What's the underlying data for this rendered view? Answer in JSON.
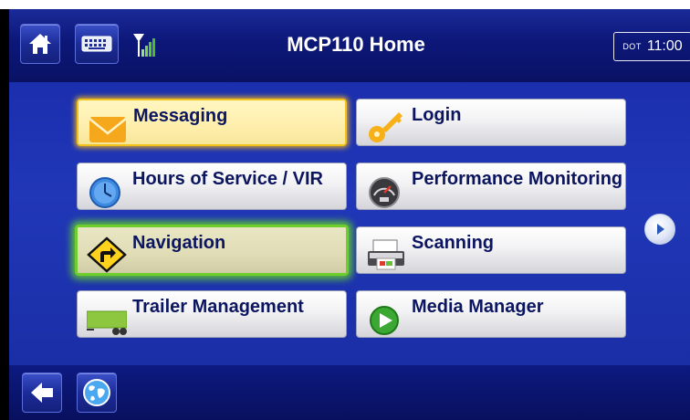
{
  "header": {
    "title": "MCP110 Home"
  },
  "status": {
    "dot_label": "DOT",
    "time": "11:00"
  },
  "menu": {
    "messaging": "Messaging",
    "login": "Login",
    "hours_of_service": "Hours of Service / VIR",
    "performance_monitoring": "Performance Monitoring",
    "navigation": "Navigation",
    "scanning": "Scanning",
    "trailer_management": "Trailer Management",
    "media_manager": "Media Manager"
  },
  "colors": {
    "background_blue": "#1f34b4",
    "selected_yellow_border": "#f2c21a",
    "selected_green_border": "#6ecf2c",
    "label_text": "#0c1660"
  },
  "icons": {
    "home": "home-icon",
    "keyboard": "keyboard-icon",
    "signal": "signal-strength-icon",
    "back": "back-arrow-icon",
    "globe": "globe-icon",
    "next": "next-page-icon"
  }
}
